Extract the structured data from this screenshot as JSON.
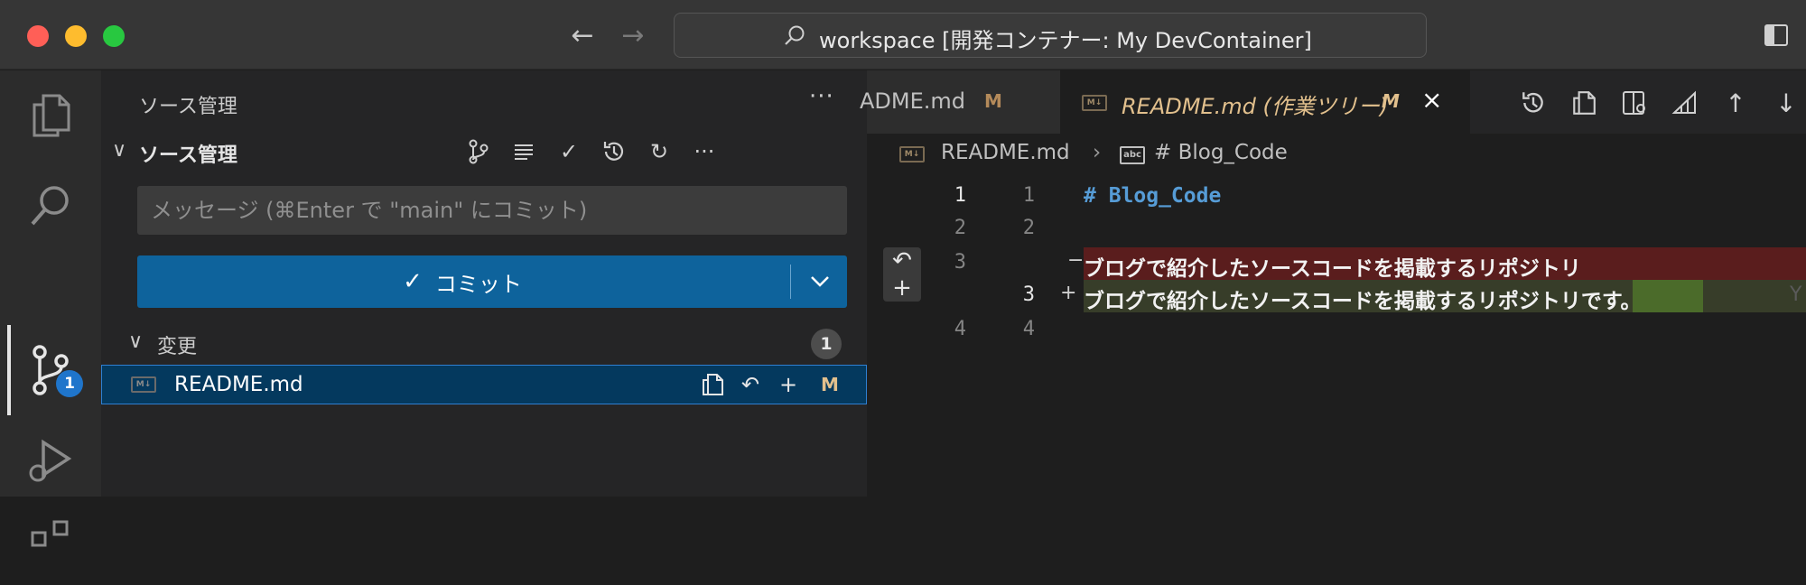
{
  "titlebar": {
    "nav_back": "←",
    "nav_forward": "→",
    "command_center": "workspace [開発コンテナー: My DevContainer]"
  },
  "activity": {
    "scm_badge": "1"
  },
  "sidebar": {
    "title": "ソース管理",
    "more": "···",
    "scm_section": "ソース管理",
    "message_placeholder": "メッセージ (⌘Enter で \"main\" にコミット)",
    "commit_label": "コミット",
    "changes_label": "変更",
    "changes_count": "1",
    "file": {
      "name": "README.md",
      "status": "M",
      "icon_text": "M↓"
    }
  },
  "editor": {
    "tab_inactive": "ADME.md",
    "tab_inactive_status": "M",
    "tab_active": "README.md (作業ツリー)",
    "tab_active_status": "M",
    "close": "×",
    "breadcrumb_file": "README.md",
    "breadcrumb_sep": "›",
    "breadcrumb_symbol": "# Blog_Code",
    "breadcrumb_symbol_icon": "abc",
    "lines": [
      {
        "orig": "1",
        "mod": "1",
        "text": "# Blog_Code"
      },
      {
        "orig": "2",
        "mod": "2",
        "text": ""
      },
      {
        "orig": "3",
        "mod": "",
        "marker": "−",
        "text": "ブログで紹介したソースコードを掲載するリポジトリ"
      },
      {
        "orig": "",
        "mod": "3",
        "marker": "+",
        "text": "ブログで紹介したソースコードを掲載するリポジトリです。"
      },
      {
        "orig": "4",
        "mod": "4",
        "text": ""
      }
    ],
    "ghost_text": "Y"
  },
  "colors": {
    "accent": "#0e639c",
    "modified": "#e2c08d",
    "deleted_line": "#5a1d1d",
    "inserted_line": "#373d29"
  }
}
